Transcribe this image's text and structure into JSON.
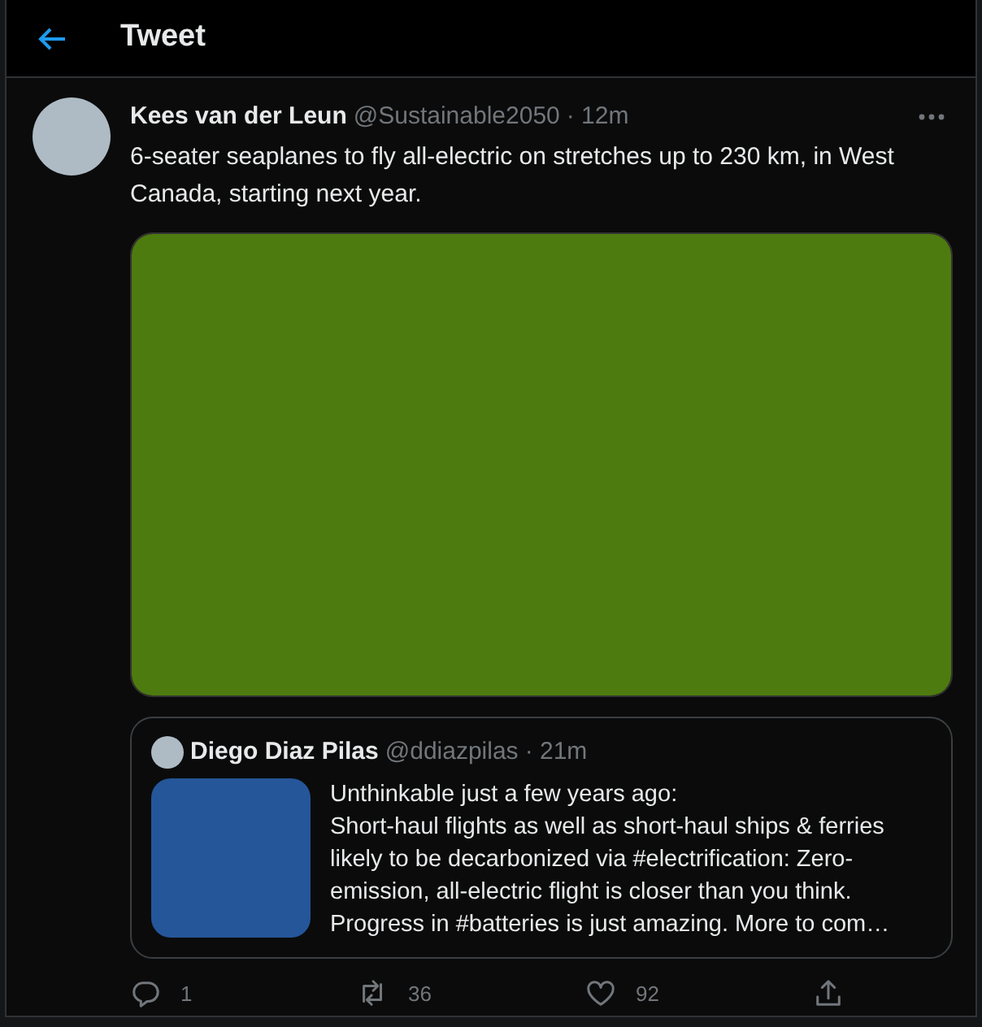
{
  "header": {
    "title": "Tweet"
  },
  "tweet": {
    "author": "Kees van der Leun",
    "handle": "@Sustainable2050",
    "time": "· 12m",
    "text": "6-seater seaplanes to fly all-electric on stretches up to 230 km, in West Canada, starting next year.",
    "quote": {
      "author": "Diego Diaz Pilas",
      "handle": "@ddiazpilas",
      "time": "· 21m",
      "text": "Unthinkable just a few years ago:\nShort-haul flights as well as short-haul ships & ferries likely to be decarbonized via #electrification: Zero-emission, all-electric flight is closer than you think. Progress in #batteries is just amazing. More to com…"
    },
    "actions": [
      {
        "kind": "reply",
        "count": "1"
      },
      {
        "kind": "retweet",
        "count": "36"
      },
      {
        "kind": "like",
        "count": "92"
      },
      {
        "kind": "share"
      }
    ]
  }
}
